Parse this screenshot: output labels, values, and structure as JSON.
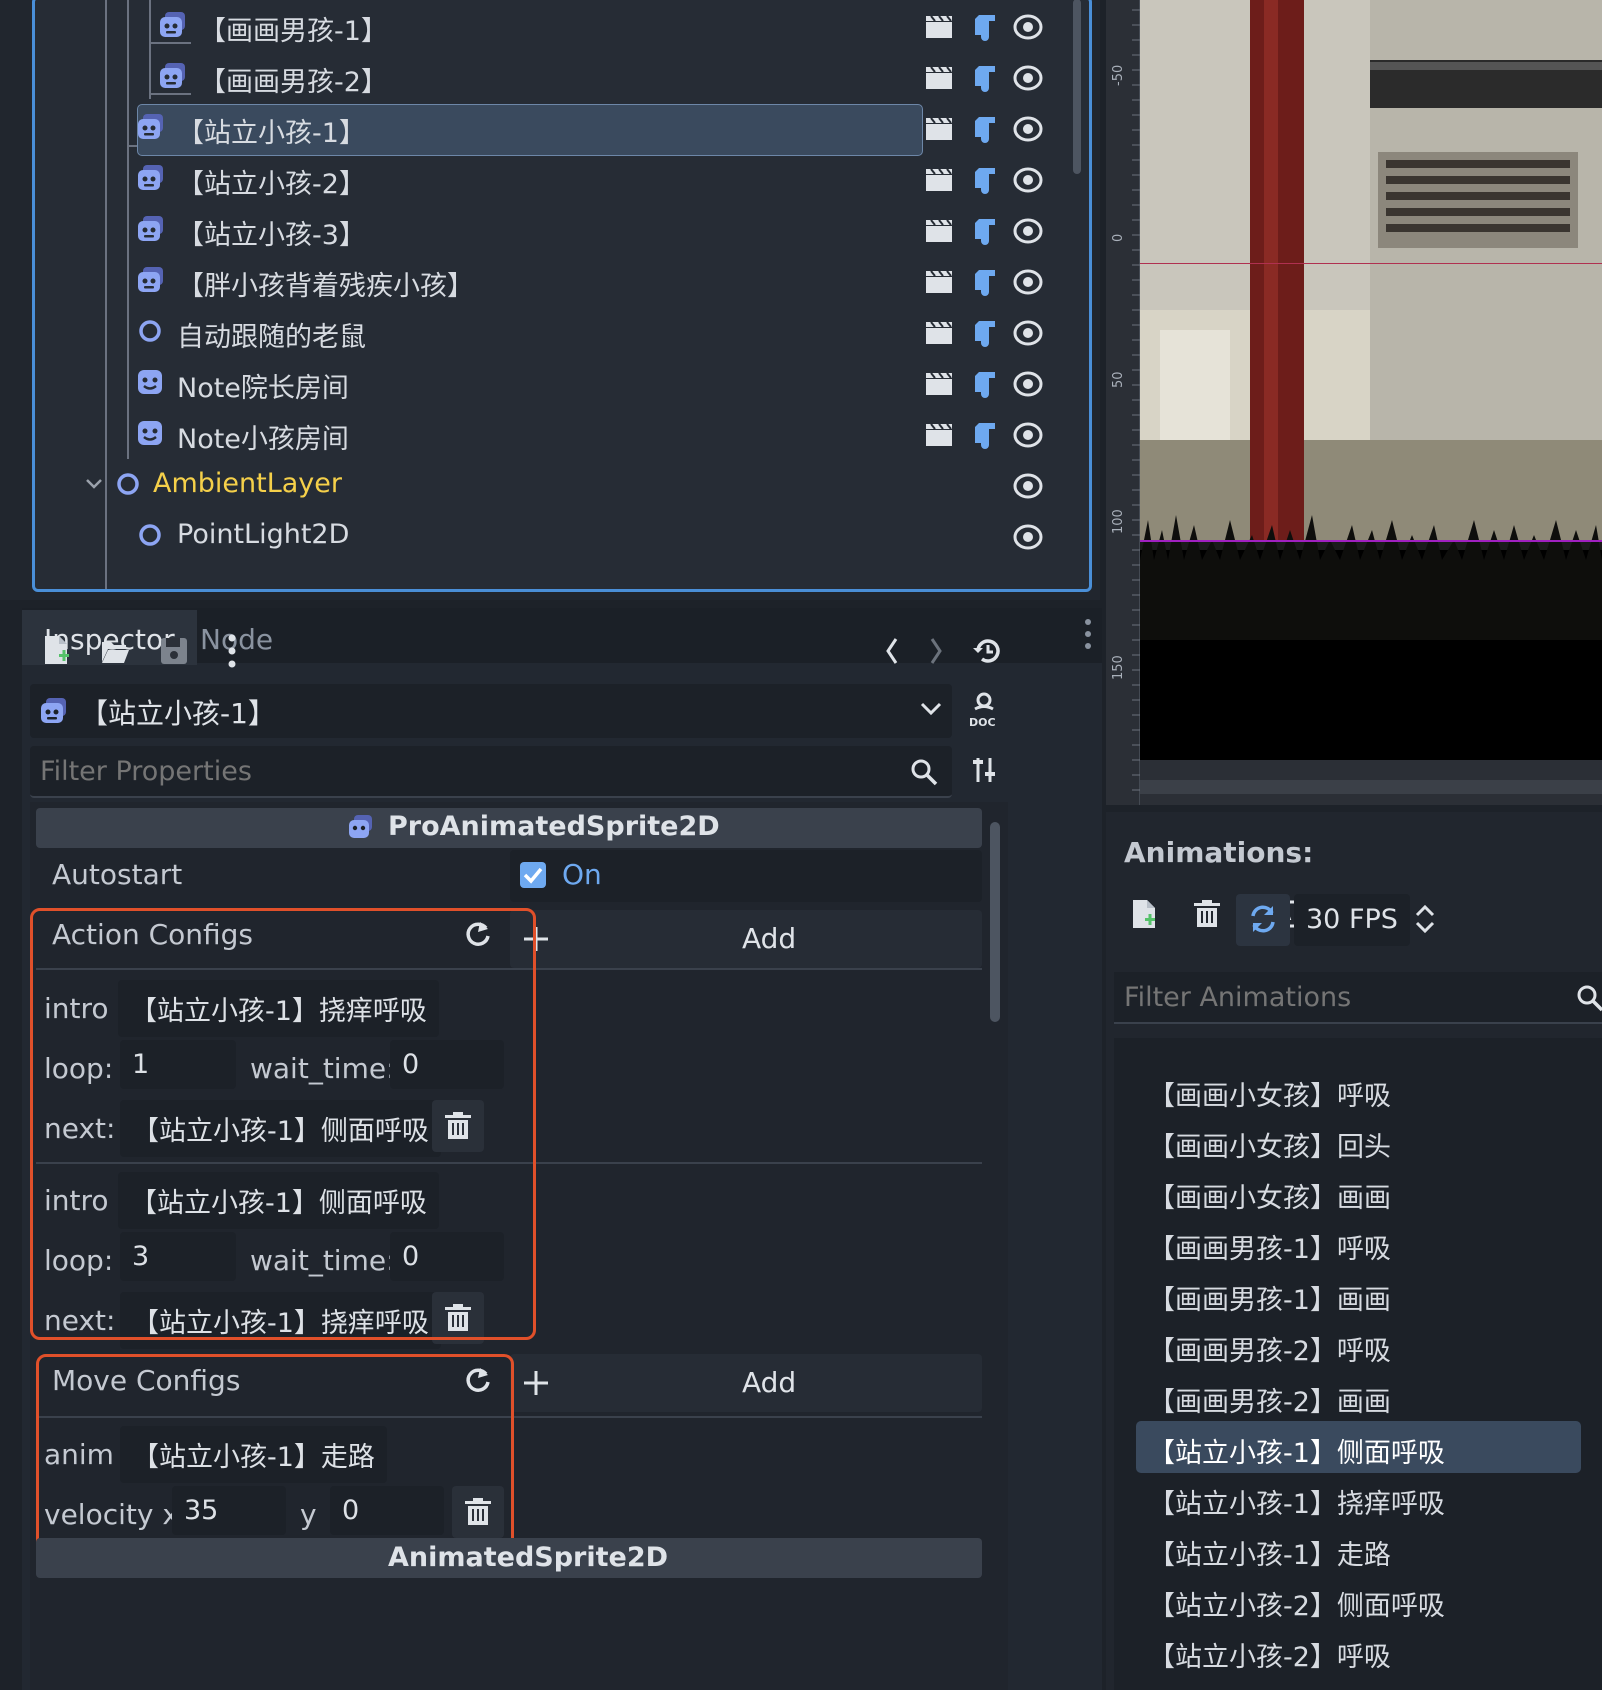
{
  "scene_tree": {
    "rows": [
      {
        "label": "【画画男孩-1】",
        "icon": "animated-sprite-icon"
      },
      {
        "label": "【画画男孩-2】",
        "icon": "animated-sprite-icon"
      },
      {
        "label": "【站立小孩-1】",
        "icon": "animated-sprite-icon",
        "selected": true
      },
      {
        "label": "【站立小孩-2】",
        "icon": "animated-sprite-icon"
      },
      {
        "label": "【站立小孩-3】",
        "icon": "animated-sprite-icon"
      },
      {
        "label": "【胖小孩背着残疾小孩】",
        "icon": "animated-sprite-icon"
      },
      {
        "label": "自动跟随的老鼠",
        "icon": "node2d-icon"
      },
      {
        "label": "Note院长房间",
        "icon": "sprite-icon"
      },
      {
        "label": "Note小孩房间",
        "icon": "sprite-icon"
      },
      {
        "label": "AmbientLayer",
        "icon": "canvas-layer-icon"
      },
      {
        "label": "PointLight2D",
        "icon": "pointlight-icon"
      }
    ]
  },
  "inspector": {
    "tabs": [
      "Inspector",
      "Node"
    ],
    "object_name": "【站立小孩-1】",
    "filter_placeholder": "Filter Properties",
    "class_name": "ProAnimatedSprite2D",
    "autostart_label": "Autostart",
    "autostart_value": "On",
    "autostart_checked": true,
    "action_configs": {
      "label": "Action Configs",
      "add_label": "Add",
      "items": [
        {
          "intro_label": "intro",
          "intro": "【站立小孩-1】挠痒呼吸",
          "loop_label": "loop:",
          "loop": "1",
          "wait_label": "wait_time:",
          "wait_time": "0",
          "next_label": "next:",
          "next": "【站立小孩-1】侧面呼吸"
        },
        {
          "intro_label": "intro",
          "intro": "【站立小孩-1】侧面呼吸",
          "loop_label": "loop:",
          "loop": "3",
          "wait_label": "wait_time:",
          "wait_time": "0",
          "next_label": "next:",
          "next": "【站立小孩-1】挠痒呼吸"
        }
      ]
    },
    "move_configs": {
      "label": "Move Configs",
      "add_label": "Add",
      "anim_label": "anim",
      "anim": "【站立小孩-1】走路",
      "velocity_label": "velocity x",
      "velocity_x": "35",
      "y_label": "y",
      "velocity_y": "0"
    },
    "next_class_name": "AnimatedSprite2D"
  },
  "viewport": {
    "ruler_labels": [
      "-50",
      "0",
      "50",
      "100",
      "150"
    ]
  },
  "animations": {
    "title": "Animations:",
    "fps": "30 FPS",
    "filter_placeholder": "Filter Animations",
    "items": [
      "【画画小女孩】呼吸",
      "【画画小女孩】回头",
      "【画画小女孩】画画",
      "【画画男孩-1】呼吸",
      "【画画男孩-1】画画",
      "【画画男孩-2】呼吸",
      "【画画男孩-2】画画",
      "【站立小孩-1】侧面呼吸",
      "【站立小孩-1】挠痒呼吸",
      "【站立小孩-1】走路",
      "【站立小孩-2】侧面呼吸",
      "【站立小孩-2】呼吸"
    ],
    "selected_index": 7
  },
  "colors": {
    "accent": "#4a8fd8",
    "highlight_red": "#e0502a",
    "yellow_node": "#f5d04a",
    "selection": "#3a4a5e"
  }
}
